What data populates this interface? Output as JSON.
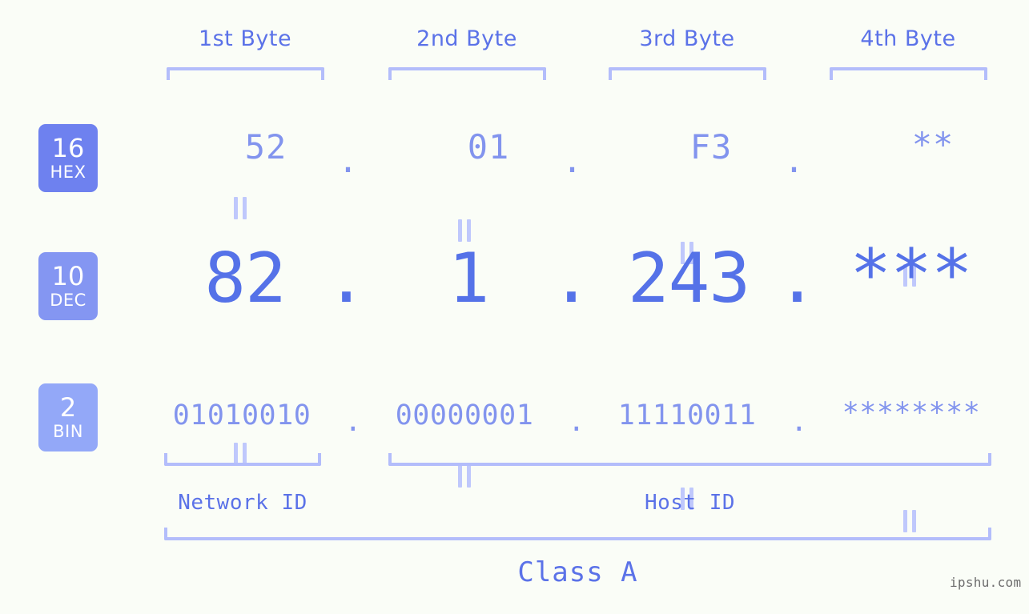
{
  "page": {
    "background_color": "#fafdf7",
    "accent_color": "#5b72e8",
    "accent_light_color": "#8294ee",
    "bracket_color": "#b3bdfb",
    "watermark": "ipshu.com"
  },
  "byte_headers": [
    {
      "label": "1st Byte"
    },
    {
      "label": "2nd Byte"
    },
    {
      "label": "3rd Byte"
    },
    {
      "label": "4th Byte"
    }
  ],
  "bases": [
    {
      "num": "16",
      "abbr": "HEX",
      "color": "#6e81ef"
    },
    {
      "num": "10",
      "abbr": "DEC",
      "color": "#8496f2"
    },
    {
      "num": "2",
      "abbr": "BIN",
      "color": "#93a8f8"
    }
  ],
  "rows": {
    "hex": {
      "bytes": [
        "52",
        "01",
        "F3",
        "**"
      ],
      "text": "52  .  01  .  F3  .  **"
    },
    "dec": {
      "bytes": [
        "82",
        "1",
        "243",
        "***"
      ],
      "text": "82 . 1 .243.***"
    },
    "bin": {
      "bytes": [
        "01010010",
        "00000001",
        "11110011",
        "********"
      ],
      "text": "01010010 . 00000001 . 11110011 . ********"
    }
  },
  "separators": {
    "dot": ".",
    "equals": "||"
  },
  "id_sections": [
    {
      "label": "Network ID"
    },
    {
      "label": "Host ID"
    }
  ],
  "class_section": {
    "label": "Class A"
  }
}
